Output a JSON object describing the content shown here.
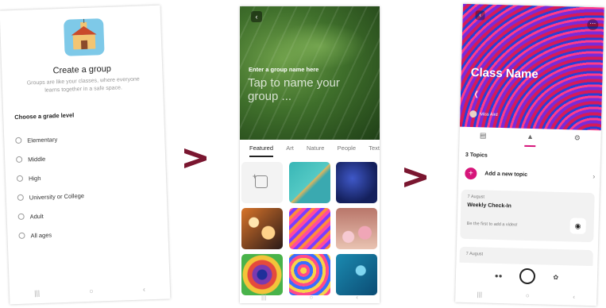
{
  "screen1": {
    "title": "Create a group",
    "subtitle": "Groups are like your classes, where everyone learns together in a safe space.",
    "choose_label": "Choose a grade level",
    "options": [
      "Elementary",
      "Middle",
      "High",
      "University or College",
      "Adult",
      "All ages"
    ]
  },
  "screen2": {
    "hint": "Enter a group name here",
    "name_placeholder": "Tap to name your group ...",
    "tabs": [
      "Featured",
      "Art",
      "Nature",
      "People",
      "Text"
    ]
  },
  "screen3": {
    "group_name": "Class Name",
    "owner": "Miss Aird",
    "topics_count": "3 Topics",
    "add_topic": "Add a new topic",
    "cards": [
      {
        "date": "7 August",
        "name": "Weekly Check-In",
        "hint": "Be the first to add a video!"
      },
      {
        "date": "7 August",
        "name": "",
        "hint": ""
      }
    ]
  },
  "colors": {
    "accent": "#d6157a",
    "arrow": "#7a1630"
  }
}
